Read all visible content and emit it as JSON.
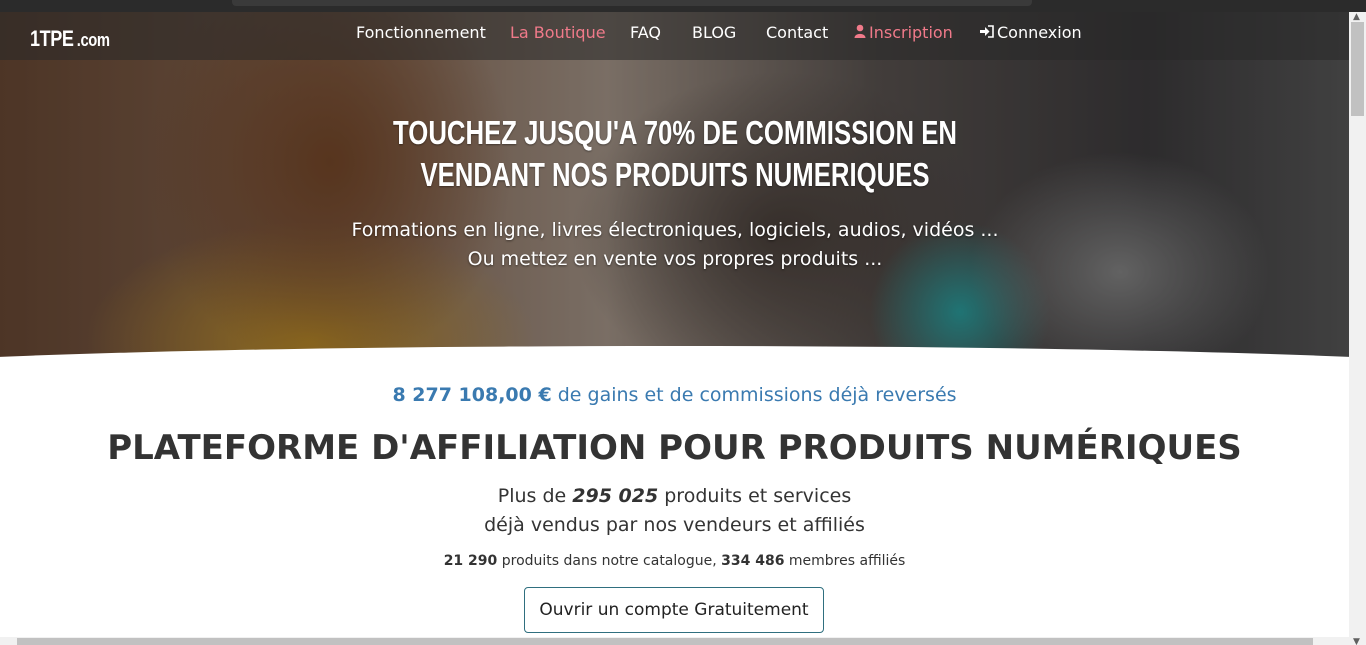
{
  "logo": {
    "main": "1TPE",
    "suffix": ".com"
  },
  "nav": {
    "items": [
      {
        "label": "Fonctionnement"
      },
      {
        "label": "La Boutique"
      },
      {
        "label": "FAQ"
      },
      {
        "label": "BLOG"
      },
      {
        "label": "Contact"
      },
      {
        "label": "Inscription",
        "icon": "user-icon"
      },
      {
        "label": "Connexion",
        "icon": "sign-in-icon"
      }
    ]
  },
  "hero": {
    "title": "TOUCHEZ JUSQU'A 70% DE COMMISSION EN VENDANT NOS PRODUITS NUMERIQUES",
    "sub_line1": "Formations en ligne, livres électroniques, logiciels, audios, vidéos ...",
    "sub_line2": "Ou mettez en vente vos propres produits ..."
  },
  "gains": {
    "amount": "8 277 108,00 €",
    "text": " de gains et de commissions déjà reversés"
  },
  "main_title": "PLATEFORME D'AFFILIATION POUR PRODUITS NUMÉRIQUES",
  "plus": {
    "prefix": "Plus de ",
    "count": "295 025",
    "suffix": " produits et services",
    "line2": "déjà vendus par nos vendeurs et affiliés"
  },
  "stats": {
    "products": "21 290",
    "products_text": " produits dans notre catalogue, ",
    "members": "334 486",
    "members_text": " membres affiliés"
  },
  "cta": {
    "label": "Ouvrir un compte Gratuitement"
  },
  "colors": {
    "accent_pink": "#f07a8a",
    "gains_blue": "#3a7ab0",
    "cta_border": "#2f6f7f"
  }
}
